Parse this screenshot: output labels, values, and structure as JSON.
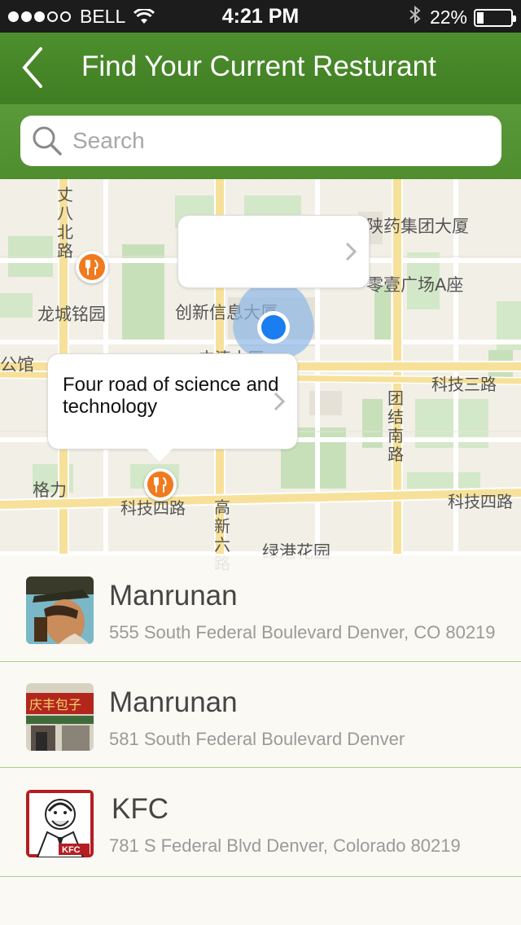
{
  "status_bar": {
    "carrier": "BELL",
    "time": "4:21 PM",
    "battery_percent": "22%"
  },
  "header": {
    "title": "Find Your Current Resturant",
    "back_icon": "chevron-left-icon"
  },
  "search": {
    "placeholder": "Search",
    "value": ""
  },
  "map": {
    "labels": {
      "road_top_left": "丈八北路",
      "longcheng": "龙城铭园",
      "gongguan": "公馆",
      "chuangxin": "创新信息大厦",
      "shaanyao": "陕药集团大厦",
      "lingyi": "零壹广场A座",
      "keji3": "科技三路",
      "tuanjie": "团结南路",
      "geli": "格力",
      "keji4_left": "科技四路",
      "gaoxin6": "高新六路",
      "lvgang": "绿港花园",
      "keji4_right": "科技四路",
      "yizhongda": "中清大厦"
    },
    "callout_top": {
      "text": ""
    },
    "callout_main": {
      "text": "Four road of science and technology"
    },
    "pin_icon": "restaurant-fork-knife-icon",
    "accent_color": "#f07a1d",
    "user_location_color": "#1a7df0"
  },
  "restaurants": [
    {
      "name": "Manrunan",
      "address": "555 South Federal Boulevard Denver, CO 80219"
    },
    {
      "name": "Manrunan",
      "address": "581 South Federal Boulevard Denver"
    },
    {
      "name": "KFC",
      "address": "781 S Federal Blvd Denver, Colorado 80219"
    }
  ],
  "colors": {
    "header_green": "#4d8f2e",
    "divider_green": "#a9cf93"
  }
}
